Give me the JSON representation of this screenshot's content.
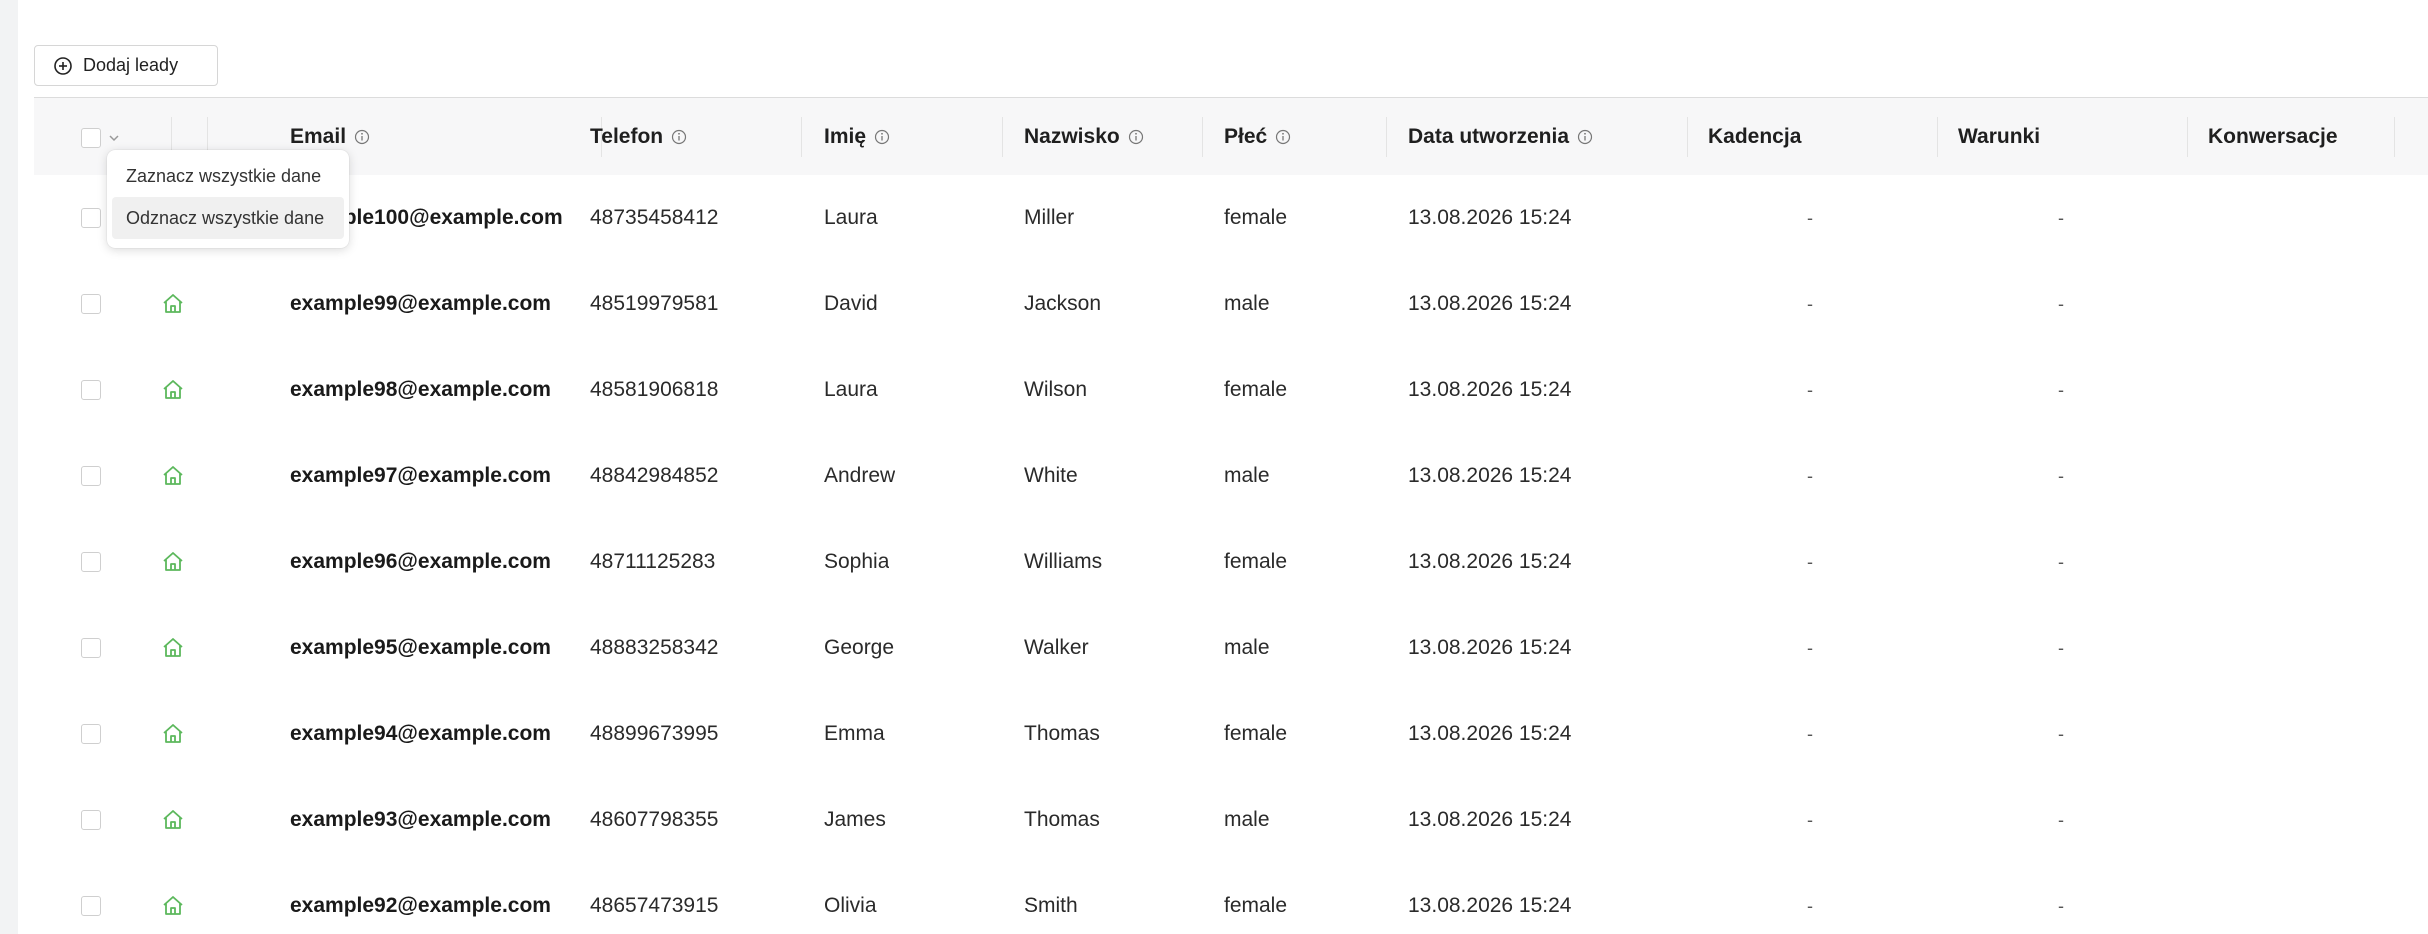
{
  "toolbar": {
    "add_leads_label": "Dodaj leady"
  },
  "table": {
    "columns": {
      "email": "Email",
      "phone": "Telefon",
      "first_name": "Imię",
      "last_name": "Nazwisko",
      "gender": "Płeć",
      "created": "Data utworzenia",
      "cadence": "Kadencja",
      "conditions": "Warunki",
      "conversations": "Konwersacje"
    },
    "rows": [
      {
        "email": "example100@example.com",
        "phone": "48735458412",
        "first_name": "Laura",
        "last_name": "Miller",
        "gender": "female",
        "created": "13.08.2026 15:24",
        "cadence": "-",
        "conditions": "-"
      },
      {
        "email": "example99@example.com",
        "phone": "48519979581",
        "first_name": "David",
        "last_name": "Jackson",
        "gender": "male",
        "created": "13.08.2026 15:24",
        "cadence": "-",
        "conditions": "-"
      },
      {
        "email": "example98@example.com",
        "phone": "48581906818",
        "first_name": "Laura",
        "last_name": "Wilson",
        "gender": "female",
        "created": "13.08.2026 15:24",
        "cadence": "-",
        "conditions": "-"
      },
      {
        "email": "example97@example.com",
        "phone": "48842984852",
        "first_name": "Andrew",
        "last_name": "White",
        "gender": "male",
        "created": "13.08.2026 15:24",
        "cadence": "-",
        "conditions": "-"
      },
      {
        "email": "example96@example.com",
        "phone": "48711125283",
        "first_name": "Sophia",
        "last_name": "Williams",
        "gender": "female",
        "created": "13.08.2026 15:24",
        "cadence": "-",
        "conditions": "-"
      },
      {
        "email": "example95@example.com",
        "phone": "48883258342",
        "first_name": "George",
        "last_name": "Walker",
        "gender": "male",
        "created": "13.08.2026 15:24",
        "cadence": "-",
        "conditions": "-"
      },
      {
        "email": "example94@example.com",
        "phone": "48899673995",
        "first_name": "Emma",
        "last_name": "Thomas",
        "gender": "female",
        "created": "13.08.2026 15:24",
        "cadence": "-",
        "conditions": "-"
      },
      {
        "email": "example93@example.com",
        "phone": "48607798355",
        "first_name": "James",
        "last_name": "Thomas",
        "gender": "male",
        "created": "13.08.2026 15:24",
        "cadence": "-",
        "conditions": "-"
      },
      {
        "email": "example92@example.com",
        "phone": "48657473915",
        "first_name": "Olivia",
        "last_name": "Smith",
        "gender": "female",
        "created": "13.08.2026 15:24",
        "cadence": "-",
        "conditions": "-"
      }
    ]
  },
  "select_menu": {
    "select_all": "Zaznacz wszystkie dane",
    "deselect_all": "Odznacz wszystkie dane"
  },
  "colors": {
    "home_icon": "#5cb85c",
    "header_bg": "#f7f7f8",
    "row_border": "#ececec"
  }
}
